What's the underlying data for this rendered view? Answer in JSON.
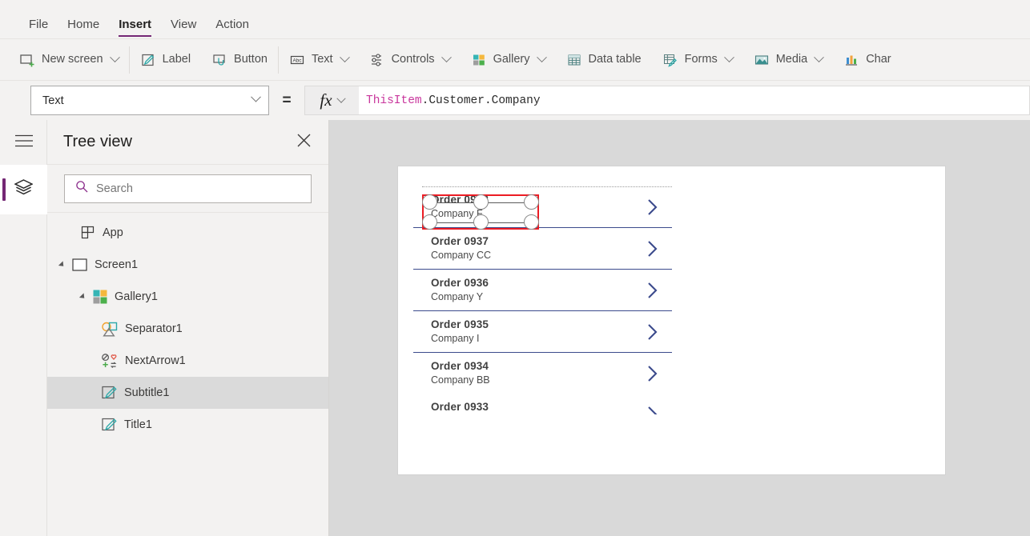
{
  "menu": {
    "items": [
      {
        "label": "File",
        "active": false
      },
      {
        "label": "Home",
        "active": false
      },
      {
        "label": "Insert",
        "active": true
      },
      {
        "label": "View",
        "active": false
      },
      {
        "label": "Action",
        "active": false
      }
    ],
    "active_underline_color": "#742774"
  },
  "ribbon": {
    "groups": [
      {
        "buttons": [
          {
            "label": "New screen",
            "icon": "new-screen-icon",
            "caret": true
          }
        ]
      },
      {
        "buttons": [
          {
            "label": "Label",
            "icon": "label-icon",
            "caret": false
          },
          {
            "label": "Button",
            "icon": "button-icon",
            "caret": false
          }
        ]
      },
      {
        "buttons": [
          {
            "label": "Text",
            "icon": "text-abc-icon",
            "caret": true
          },
          {
            "label": "Controls",
            "icon": "controls-icon",
            "caret": true
          },
          {
            "label": "Gallery",
            "icon": "gallery-icon",
            "caret": true
          },
          {
            "label": "Data table",
            "icon": "datatable-icon",
            "caret": false
          },
          {
            "label": "Forms",
            "icon": "forms-icon",
            "caret": true
          },
          {
            "label": "Media",
            "icon": "media-icon",
            "caret": true
          },
          {
            "label": "Char",
            "icon": "chart-icon",
            "caret": false
          }
        ]
      }
    ]
  },
  "formula_bar": {
    "property": "Text",
    "equals": "=",
    "fx_label": "fx",
    "formula_identifier": "ThisItem",
    "formula_rest": ".Customer.Company",
    "identifier_color": "#c9379d"
  },
  "rail": {
    "hamburger_icon": "hamburger-icon",
    "layers_icon": "layers-icon",
    "active_indicator_color": "#742774"
  },
  "tree_panel": {
    "title": "Tree view",
    "close_icon": "close-icon",
    "search": {
      "icon": "search-icon",
      "placeholder": "Search",
      "value": "",
      "icon_color": "#8b2d8b"
    },
    "items": [
      {
        "label": "App",
        "icon": "app-icon",
        "indent": 0,
        "twisty": false,
        "selected": false
      },
      {
        "label": "Screen1",
        "icon": "screen-icon",
        "indent": 0,
        "twisty": true,
        "selected": false
      },
      {
        "label": "Gallery1",
        "icon": "gallery-icon",
        "indent": 1,
        "twisty": true,
        "selected": false
      },
      {
        "label": "Separator1",
        "icon": "shapes-icon",
        "indent": 2,
        "twisty": false,
        "selected": false
      },
      {
        "label": "NextArrow1",
        "icon": "iconset-icon",
        "indent": 2,
        "twisty": false,
        "selected": false
      },
      {
        "label": "Subtitle1",
        "icon": "label-edit-icon",
        "indent": 2,
        "twisty": false,
        "selected": true
      },
      {
        "label": "Title1",
        "icon": "label-edit-icon",
        "indent": 2,
        "twisty": false,
        "selected": false
      }
    ]
  },
  "canvas": {
    "background_color": "#d9d9d9",
    "screen_background": "#ffffff",
    "selection_outline_color": "#ec1c24",
    "chevron_color": "#3b4a8c",
    "gallery": {
      "rows": [
        {
          "title": "Order 0938",
          "subtitle": "Company F",
          "selected": true,
          "clipped": false
        },
        {
          "title": "Order 0937",
          "subtitle": "Company CC",
          "selected": false,
          "clipped": false
        },
        {
          "title": "Order 0936",
          "subtitle": "Company Y",
          "selected": false,
          "clipped": false
        },
        {
          "title": "Order 0935",
          "subtitle": "Company I",
          "selected": false,
          "clipped": false
        },
        {
          "title": "Order 0934",
          "subtitle": "Company BB",
          "selected": false,
          "clipped": false
        }
      ],
      "clipped_row": {
        "title": "Order 0933",
        "subtitle": "",
        "clipped": true
      }
    }
  }
}
